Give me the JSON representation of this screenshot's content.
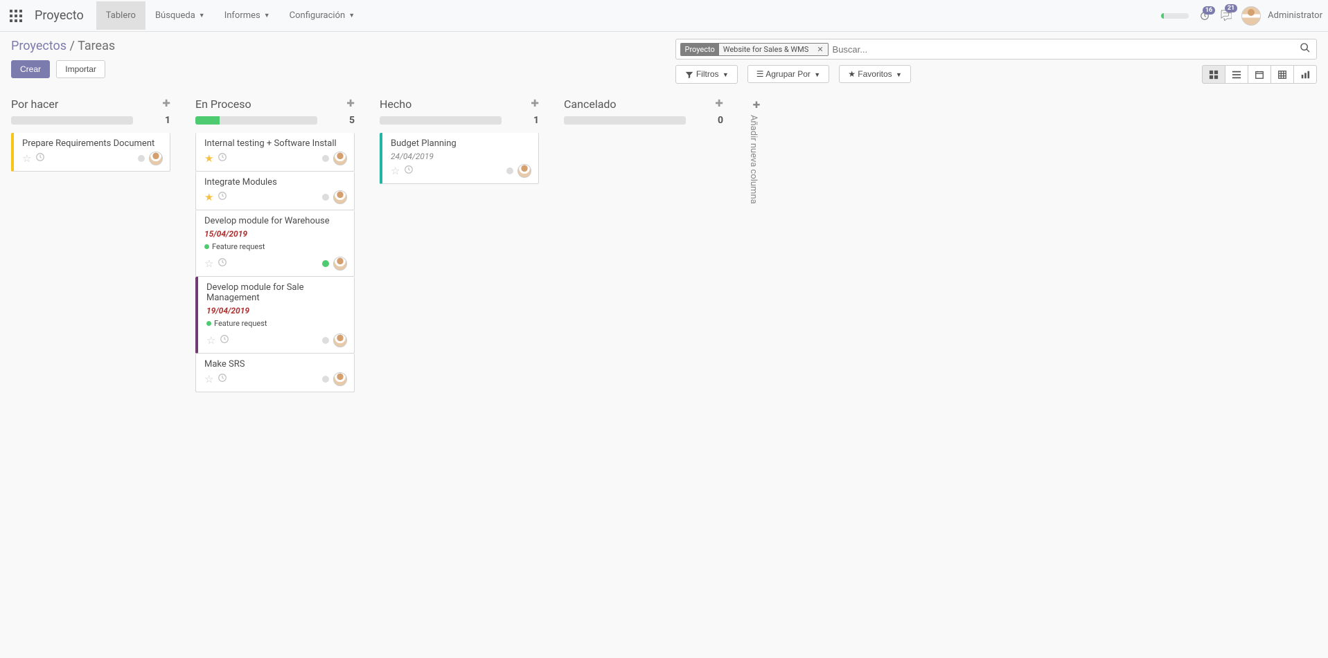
{
  "nav": {
    "app_title": "Proyecto",
    "items": [
      "Tablero",
      "Búsqueda",
      "Informes",
      "Configuración"
    ],
    "active": 0,
    "badges": {
      "activities": "16",
      "messages": "21"
    },
    "user_name": "Administrator"
  },
  "breadcrumb": {
    "parent": "Proyectos",
    "current": "Tareas"
  },
  "buttons": {
    "create": "Crear",
    "import": "Importar"
  },
  "search": {
    "facet_label": "Proyecto",
    "facet_value": "Website for Sales & WMS",
    "placeholder": "Buscar..."
  },
  "filters": {
    "filters": "Filtros",
    "groupby": "Agrupar Por",
    "favorites": "Favoritos"
  },
  "add_column_label": "Añadir nueva columna",
  "columns": [
    {
      "title": "Por hacer",
      "count": "1",
      "progress_pct": 0,
      "cards": [
        {
          "title": "Prepare Requirements Document",
          "starred": false,
          "stripe": "yellow"
        }
      ]
    },
    {
      "title": "En Proceso",
      "count": "5",
      "progress_pct": 20,
      "cards": [
        {
          "title": "Internal testing + Software Install",
          "starred": true
        },
        {
          "title": "Integrate Modules",
          "starred": true
        },
        {
          "title": "Develop module for Warehouse",
          "date": "15/04/2019",
          "overdue": true,
          "tag": "Feature request",
          "starred": false,
          "status_green": true
        },
        {
          "title": "Develop module for Sale Management",
          "date": "19/04/2019",
          "overdue": true,
          "tag": "Feature request",
          "starred": false,
          "stripe": "purple"
        },
        {
          "title": "Make SRS",
          "starred": false
        }
      ]
    },
    {
      "title": "Hecho",
      "count": "1",
      "progress_pct": 0,
      "cards": [
        {
          "title": "Budget Planning",
          "date": "24/04/2019",
          "overdue": false,
          "starred": false,
          "stripe": "teal"
        }
      ]
    },
    {
      "title": "Cancelado",
      "count": "0",
      "progress_pct": 0,
      "cards": []
    }
  ]
}
